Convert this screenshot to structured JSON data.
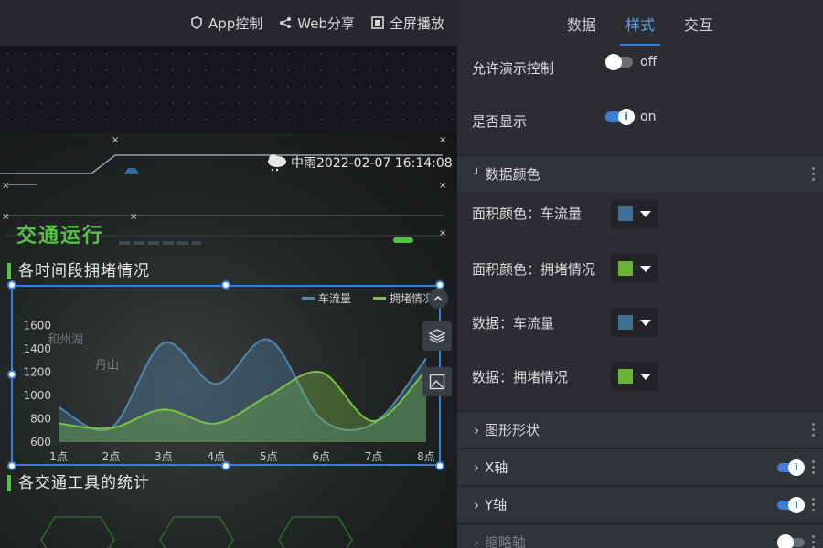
{
  "toolbar": {
    "app_control": "App控制",
    "web_share": "Web分享",
    "fullscreen": "全屏播放"
  },
  "canvas": {
    "weather_text": "中雨2022-02-07 16:14:08",
    "section_title": "交通运行",
    "chart1_title": "各时间段拥堵情况",
    "chart2_title": "各交通工具的统计",
    "map_labels": [
      "和州湖",
      "丹山"
    ]
  },
  "chart_data": {
    "type": "area",
    "categories": [
      "1点",
      "2点",
      "3点",
      "4点",
      "5点",
      "6点",
      "7点",
      "8点"
    ],
    "y_ticks": [
      "600",
      "800",
      "1000",
      "1200",
      "1400",
      "1600"
    ],
    "ylim": [
      600,
      1700
    ],
    "series": [
      {
        "name": "车流量",
        "color": "#4f86b0",
        "values": [
          900,
          720,
          1450,
          1100,
          1480,
          800,
          760,
          1320
        ]
      },
      {
        "name": "拥堵情况",
        "color": "#7ac143",
        "values": [
          760,
          720,
          880,
          760,
          1000,
          1200,
          780,
          1220
        ]
      }
    ],
    "legend": "top-right"
  },
  "panel": {
    "tabs": [
      "数据",
      "样式",
      "交互"
    ],
    "active_tab": "样式",
    "allow_demo_label": "允许演示控制",
    "allow_demo_state": "off",
    "show_label": "是否显示",
    "show_state": "on",
    "data_color_group": "数据颜色",
    "area_color_flow": "面积颜色：车流量",
    "area_color_congestion": "面积颜色：拥堵情况",
    "data_flow": "数据：车流量",
    "data_congestion": "数据：拥堵情况",
    "colors": {
      "flow": "#3d7096",
      "congestion": "#6ab234",
      "accent": "#3a7fd6"
    },
    "shape_group": "图形形状",
    "x_axis_group": "X轴",
    "y_axis_group": "Y轴",
    "zoom_axis_group": "缩略轴"
  }
}
